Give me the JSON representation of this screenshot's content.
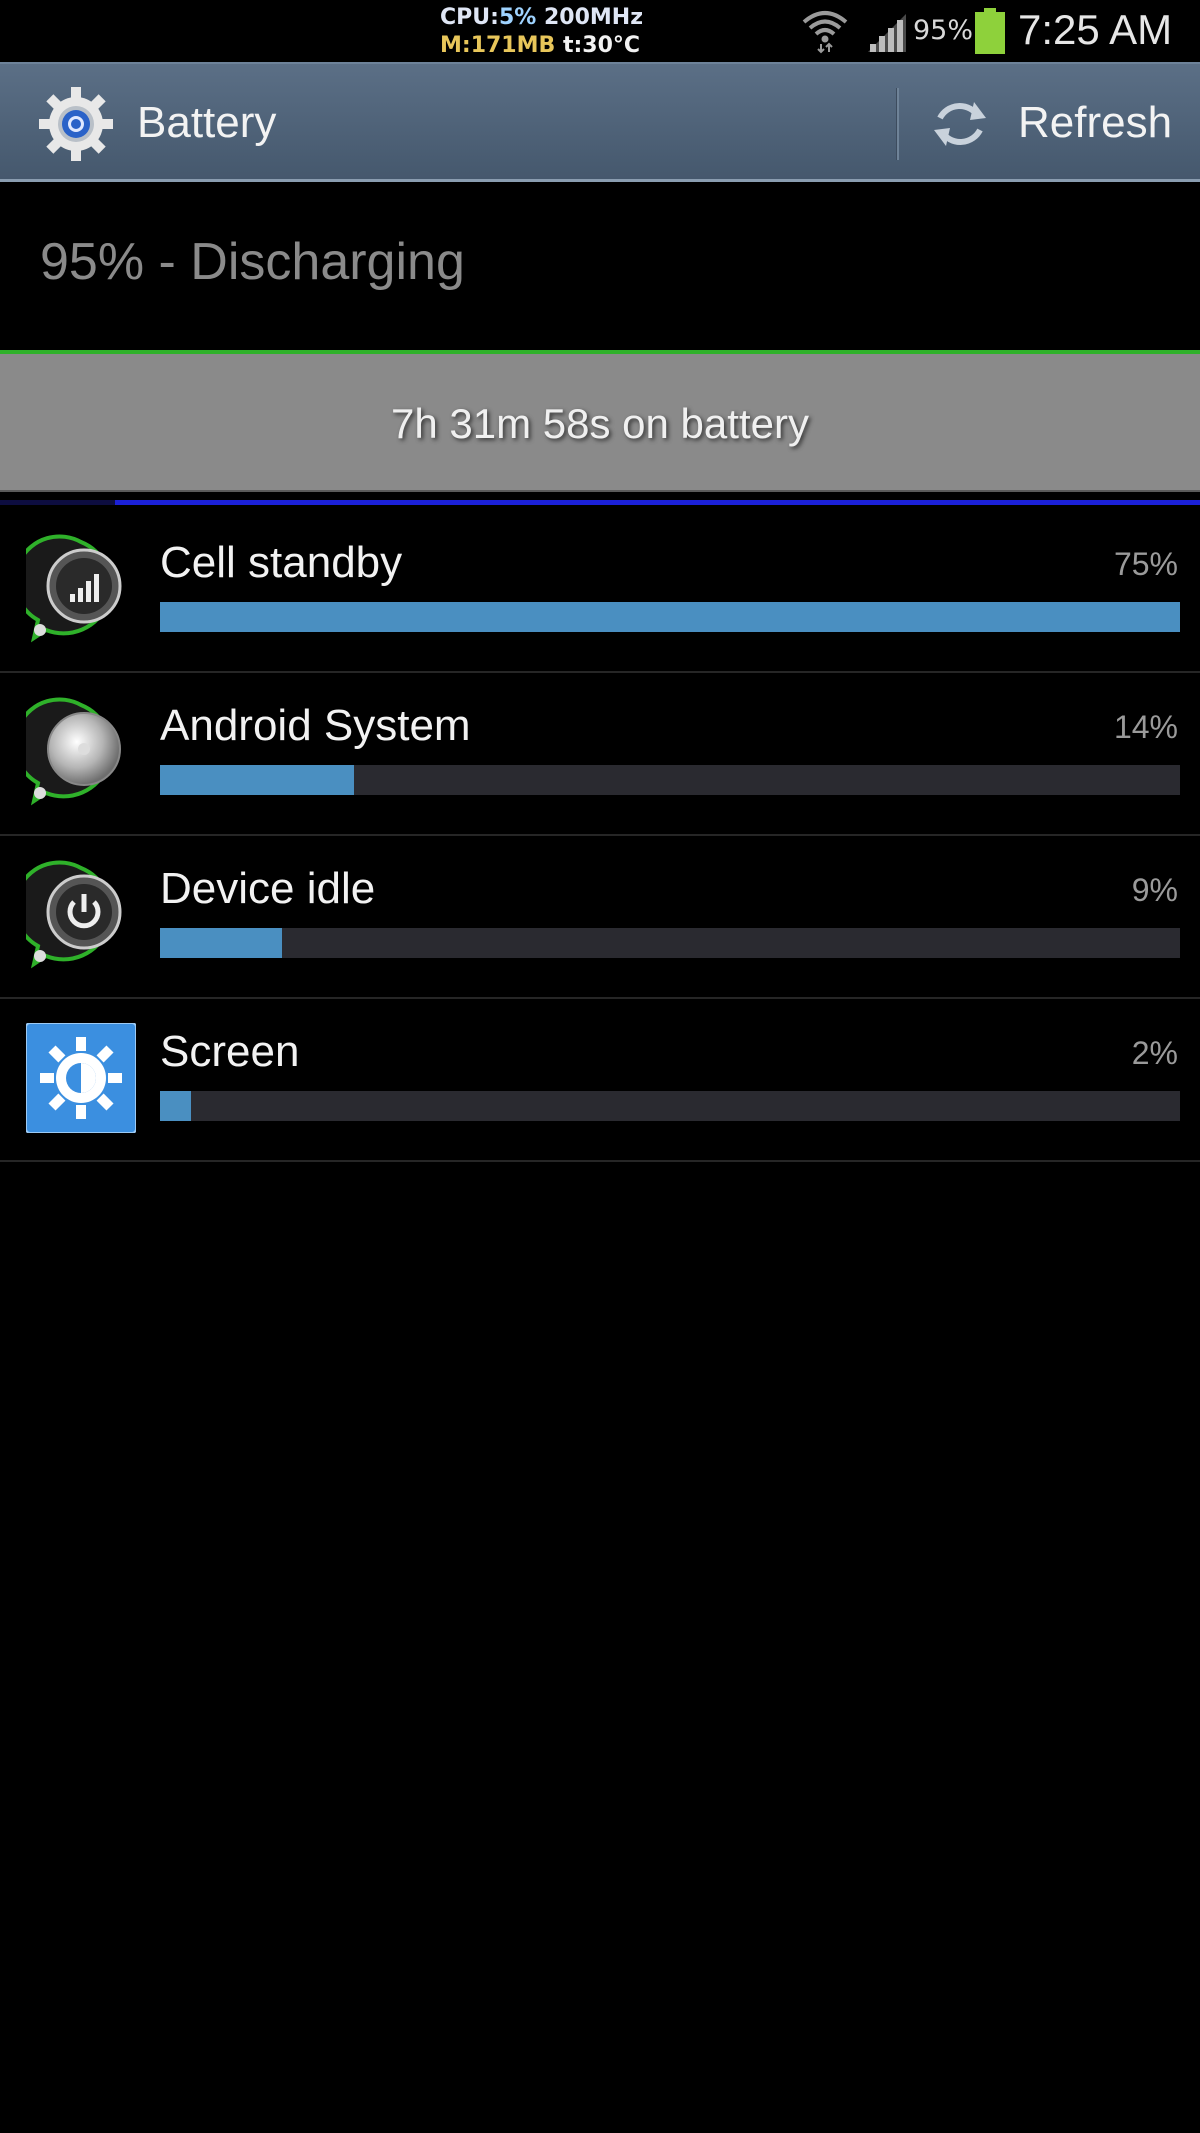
{
  "status_bar": {
    "cpu_label": "CPU:",
    "cpu_value": "5%",
    "cpu_freq": "200MHz",
    "mem": "M:171MB",
    "temp": "t:30°C",
    "battery_percent": "95%",
    "time": "7:25 AM",
    "icons": [
      "wifi-icon",
      "signal-icon",
      "battery-icon"
    ]
  },
  "action_bar": {
    "title": "Battery",
    "refresh_label": "Refresh",
    "icons": [
      "settings-gear-icon",
      "refresh-icon"
    ]
  },
  "battery": {
    "status": "95% - Discharging",
    "time_on_battery": "7h 31m 58s on battery"
  },
  "usage_items": [
    {
      "name": "Cell standby",
      "percent_label": "75%",
      "fill": 1.0,
      "icon": "cell-standby-icon"
    },
    {
      "name": "Android System",
      "percent_label": "14%",
      "fill": 0.19,
      "icon": "android-system-icon"
    },
    {
      "name": "Device idle",
      "percent_label": "9%",
      "fill": 0.12,
      "icon": "device-idle-icon"
    },
    {
      "name": "Screen",
      "percent_label": "2%",
      "fill": 0.03,
      "icon": "screen-brightness-icon"
    }
  ],
  "colors": {
    "action_bar": "#4f6378",
    "bar_fill": "#4a8fc1",
    "bar_track": "#2a2a30",
    "graph_line": "#2fb12a",
    "graph_fill": "#8a8a8a",
    "graph_blue": "#1b20d8"
  }
}
